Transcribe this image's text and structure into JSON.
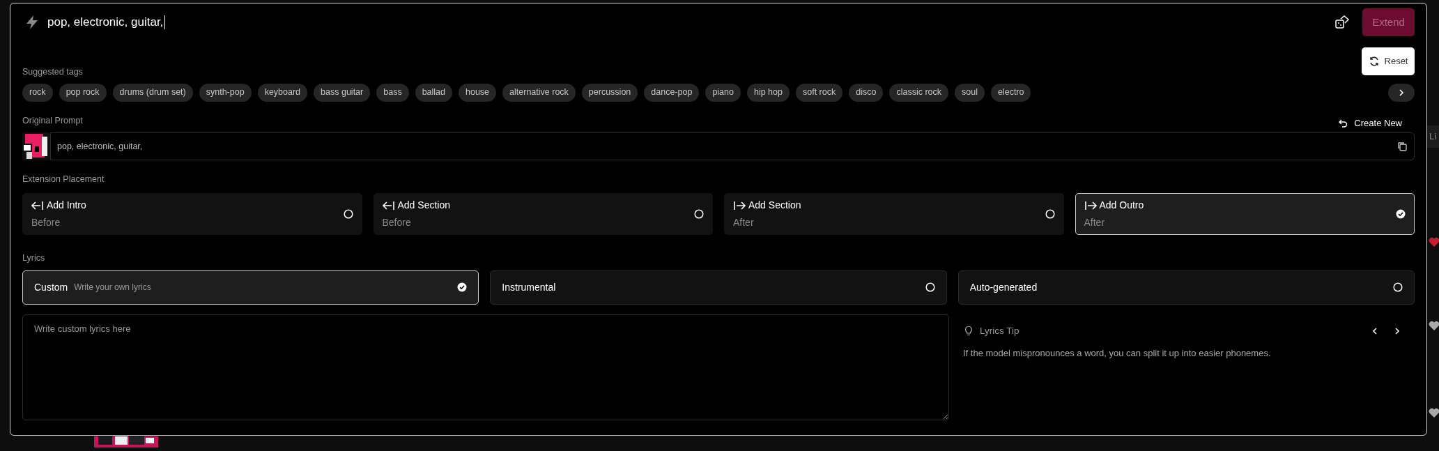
{
  "prompt_input": {
    "value": "pop, electronic, guitar,"
  },
  "extend_button": {
    "label": "Extend",
    "disabled": true
  },
  "reset_button": {
    "label": "Reset"
  },
  "suggested_tags": {
    "label": "Suggested tags",
    "tags": [
      "rock",
      "pop rock",
      "drums (drum set)",
      "synth-pop",
      "keyboard",
      "bass guitar",
      "bass",
      "ballad",
      "house",
      "alternative rock",
      "percussion",
      "dance-pop",
      "piano",
      "hip hop",
      "soft rock",
      "disco",
      "classic rock",
      "soul",
      "electro"
    ]
  },
  "original_prompt": {
    "label": "Original Prompt",
    "create_new": "Create New",
    "text": "pop, electronic, guitar,"
  },
  "extension_placement": {
    "label": "Extension Placement",
    "options": [
      {
        "title": "Add Intro",
        "subtitle": "Before",
        "kind": "before",
        "selected": false
      },
      {
        "title": "Add Section",
        "subtitle": "Before",
        "kind": "before",
        "selected": false
      },
      {
        "title": "Add Section",
        "subtitle": "After",
        "kind": "after",
        "selected": false
      },
      {
        "title": "Add Outro",
        "subtitle": "After",
        "kind": "after",
        "selected": true
      }
    ]
  },
  "lyrics": {
    "label": "Lyrics",
    "options": [
      {
        "title": "Custom",
        "hint": "Write your own lyrics",
        "selected": true
      },
      {
        "title": "Instrumental",
        "selected": false
      },
      {
        "title": "Auto-generated",
        "selected": false
      }
    ],
    "textarea": {
      "placeholder": "Write custom lyrics here"
    },
    "tip": {
      "title": "Lyrics Tip",
      "text": "If the model mispronounces a word, you can split it up into easier phonemes."
    }
  },
  "background": {
    "tab_text": "Li",
    "hearts": [
      {
        "liked": true
      },
      {
        "liked": false
      },
      {
        "liked": false
      }
    ]
  }
}
